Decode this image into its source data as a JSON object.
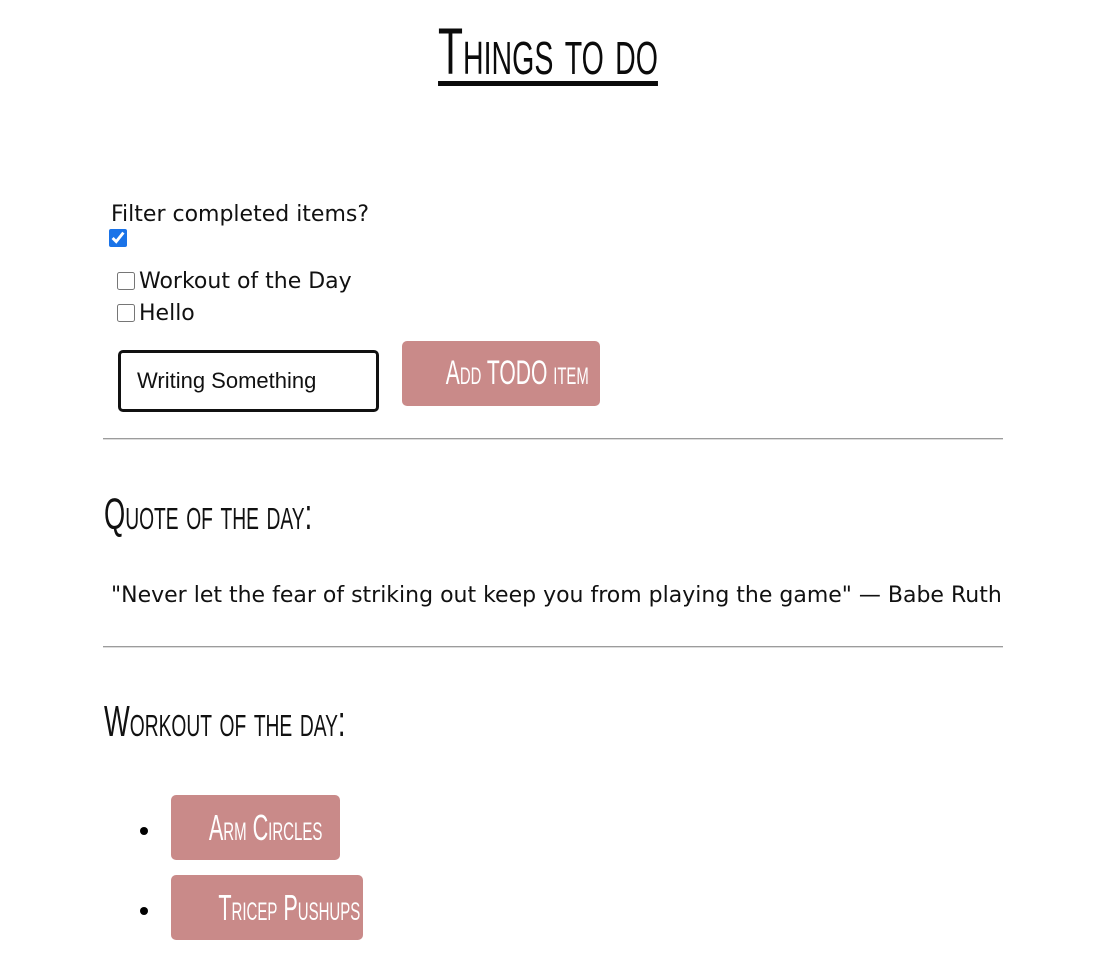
{
  "title": "Things to do",
  "filter": {
    "label": "Filter completed items?",
    "checked": true
  },
  "todos": [
    {
      "label": "Workout of the Day",
      "checked": false
    },
    {
      "label": "Hello",
      "checked": false
    }
  ],
  "add_form": {
    "input_value": "Writing Something",
    "button_label": "Add TODO item"
  },
  "quote": {
    "heading": "Quote of the day:",
    "text": "\"Never let the fear of striking out keep you from playing the game\" — Babe Ruth"
  },
  "workout": {
    "heading": "Workout of the day:",
    "items": [
      {
        "label": "Arm Circles"
      },
      {
        "label": "Tricep Pushups"
      }
    ]
  },
  "colors": {
    "button_bg": "#c98a89",
    "checkbox_accent": "#1a73e8"
  }
}
